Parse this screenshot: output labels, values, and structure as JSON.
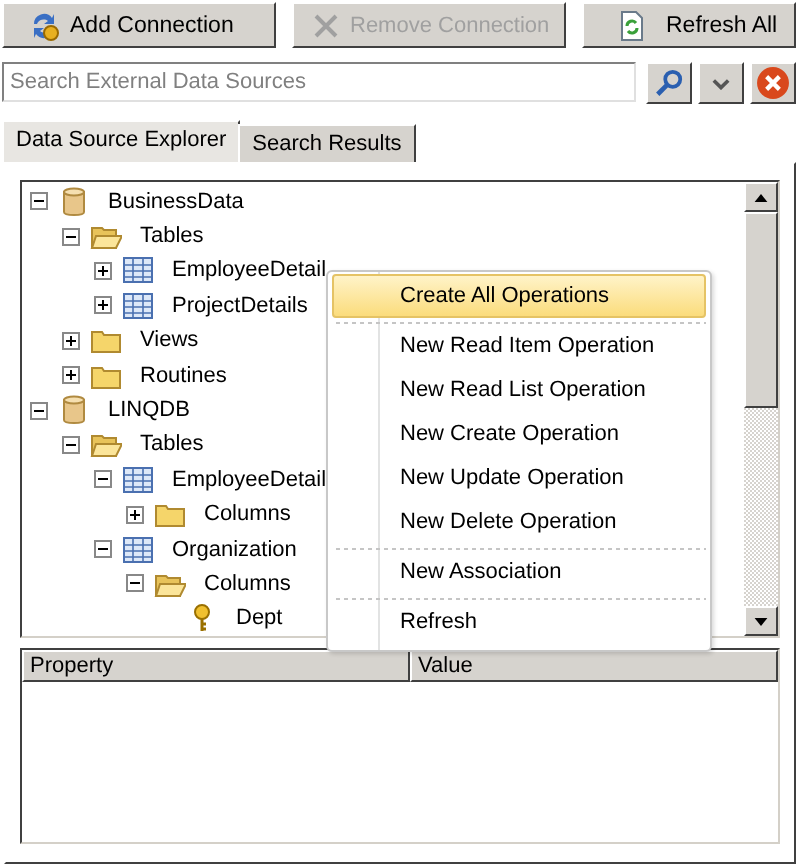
{
  "toolbar": [
    {
      "kind": "add",
      "label": "Add Connection",
      "disabled": false
    },
    {
      "kind": "remove",
      "label": "Remove Connection",
      "disabled": true
    },
    {
      "kind": "refresh",
      "label": "Refresh All",
      "disabled": false
    }
  ],
  "search": {
    "placeholder": "Search External Data Sources"
  },
  "tabs": [
    {
      "label": "Data Source Explorer",
      "selected": true
    },
    {
      "label": "Search Results",
      "selected": false
    }
  ],
  "tree": [
    {
      "kind": "database",
      "label": "BusinessData",
      "expanded": true,
      "children": [
        {
          "kind": "folder",
          "label": "Tables",
          "expanded": true,
          "children": [
            {
              "kind": "table",
              "label": "EmployeeDetail",
              "expanded": false
            },
            {
              "kind": "table",
              "label": "ProjectDetails",
              "expanded": false
            }
          ]
        },
        {
          "kind": "folder",
          "label": "Views",
          "expanded": false
        },
        {
          "kind": "folder",
          "label": "Routines",
          "expanded": false
        }
      ]
    },
    {
      "kind": "database",
      "label": "LINQDB",
      "expanded": true,
      "children": [
        {
          "kind": "folder",
          "label": "Tables",
          "expanded": true,
          "children": [
            {
              "kind": "table",
              "label": "EmployeeDetail",
              "expanded": true,
              "children": [
                {
                  "kind": "folder",
                  "label": "Columns",
                  "expanded": false
                }
              ]
            },
            {
              "kind": "table",
              "label": "Organization",
              "expanded": true,
              "children": [
                {
                  "kind": "folder",
                  "label": "Columns",
                  "expanded": true,
                  "children": [
                    {
                      "kind": "key",
                      "label": "Dept"
                    }
                  ]
                }
              ]
            }
          ]
        }
      ]
    }
  ],
  "context_menu": [
    {
      "label": "Create All Operations",
      "selected": true,
      "separator_before": false
    },
    {
      "label": "New Read Item Operation",
      "selected": false,
      "separator_before": true
    },
    {
      "label": "New Read List Operation",
      "selected": false,
      "separator_before": false
    },
    {
      "label": "New Create Operation",
      "selected": false,
      "separator_before": false
    },
    {
      "label": "New Update Operation",
      "selected": false,
      "separator_before": false
    },
    {
      "label": "New Delete Operation",
      "selected": false,
      "separator_before": false
    },
    {
      "label": "New Association",
      "selected": false,
      "separator_before": true
    },
    {
      "label": "Refresh",
      "selected": false,
      "separator_before": true
    }
  ],
  "properties": {
    "columns": [
      "Property",
      "Value"
    ]
  }
}
